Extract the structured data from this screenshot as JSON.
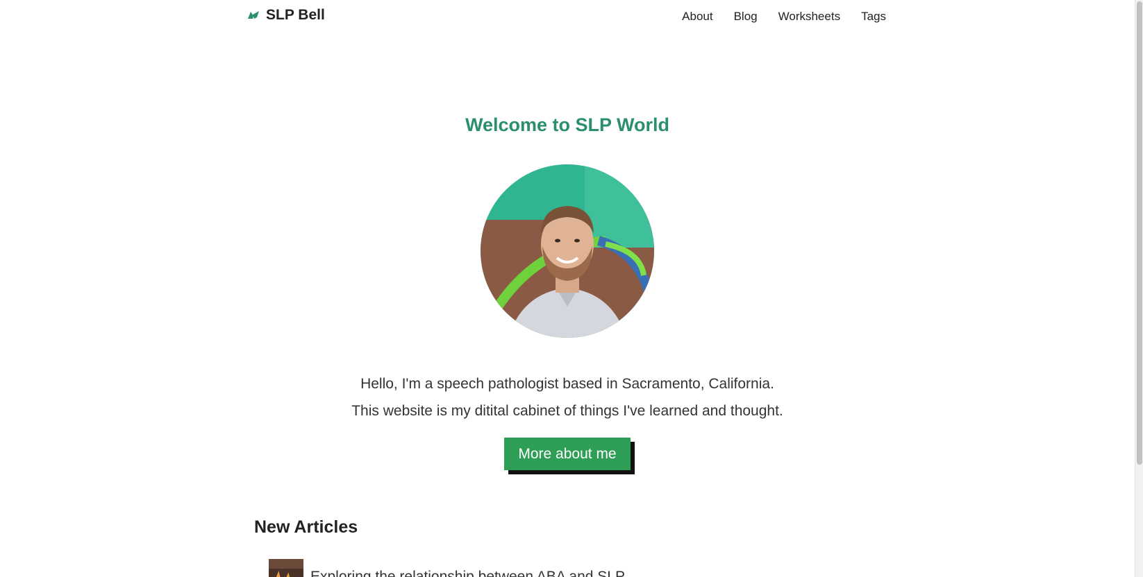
{
  "header": {
    "logo_text": "SLP Bell",
    "nav": [
      {
        "label": "About"
      },
      {
        "label": "Blog"
      },
      {
        "label": "Worksheets"
      },
      {
        "label": "Tags"
      }
    ]
  },
  "hero": {
    "title": "Welcome to SLP World",
    "intro_line_1": "Hello, I'm a speech pathologist based in Sacramento, California.",
    "intro_line_2": "This website is my ditital cabinet of things I've learned and thought.",
    "cta_label": "More about me"
  },
  "articles": {
    "section_title": "New Articles",
    "items": [
      {
        "title": "Exploring the relationship between ABA and SLP"
      }
    ]
  },
  "colors": {
    "accent": "#2a8f6a",
    "button": "#2e9e57"
  },
  "icons": {
    "logo": "bell-icon"
  }
}
